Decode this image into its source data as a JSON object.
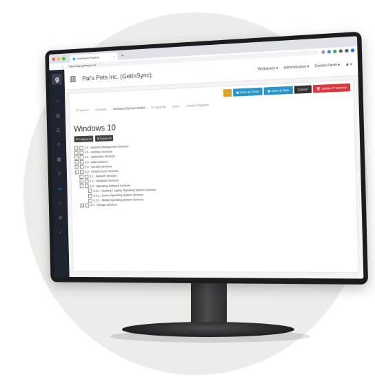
{
  "browser": {
    "tab_title": "GetInSync Platform",
    "new_tab": "+",
    "url": "https://app.getinsync.ca",
    "window_dots": [
      "#ff5f57",
      "#febc2e",
      "#28c840"
    ],
    "extension_colors": [
      "#9aa0a6",
      "#4a90d9",
      "#34a853",
      "#5f6368",
      "#5f6368",
      "#1a73e8"
    ]
  },
  "sidebar": {
    "logo": "g",
    "items": [
      "home-icon",
      "document-icon",
      "list-icon",
      "lightbulb-icon",
      "chart-icon",
      "shield-icon",
      "monitor-icon",
      "users-icon",
      "settings-icon",
      "check-icon"
    ]
  },
  "header": {
    "company": "Pal's Pets Inc. (GetInSync)",
    "nav": [
      "Workspace ▾",
      "Administration ▾",
      "Control Panel ▾",
      "♟ ▾"
    ]
  },
  "actions": {
    "info": "!",
    "save_close": "Save & Close",
    "save_new": "Save & New",
    "cancel": "Cancel",
    "delete": "Delete IT Service",
    "colors": {
      "info": "#e0a020",
      "save": "#2a95c9",
      "cancel": "#333333",
      "delete": "#d9363e"
    }
  },
  "tabs": [
    "IT Service",
    "Contacts",
    "Technical Service Model",
    "In Used By",
    "Uses",
    "Context Diagram"
  ],
  "page_title": "Windows 10",
  "tree_buttons": {
    "collapse": "Collapse All",
    "expand": "Expand All"
  },
  "tree": [
    {
      "level": 0,
      "label": "1.0 - Systems Management Services",
      "expander": "+"
    },
    {
      "level": 0,
      "label": "2.0 - Interface Services",
      "expander": "+"
    },
    {
      "level": 0,
      "label": "3.0 - Application Services",
      "expander": "+"
    },
    {
      "level": 0,
      "label": "4.0 - Data Services",
      "expander": "+"
    },
    {
      "level": 0,
      "label": "5.0 - Security Services",
      "expander": "+"
    },
    {
      "level": 0,
      "label": "6.0 - Infrastructure Services",
      "expander": "−"
    },
    {
      "level": 1,
      "label": "6.1 - Network Services",
      "expander": "+"
    },
    {
      "level": 1,
      "label": "6.2 - Hardware Services",
      "expander": "+"
    },
    {
      "level": 1,
      "label": "6.3 - Operating Software Services",
      "expander": "−"
    },
    {
      "level": 2,
      "label": "6.3.1 - Desktop / Laptop Operating System Services",
      "expander": "",
      "checked": true
    },
    {
      "level": 2,
      "label": "6.3.2 - Server Operating System Services",
      "expander": ""
    },
    {
      "level": 2,
      "label": "6.3.3 - Mobile Operating System Services",
      "expander": ""
    },
    {
      "level": 1,
      "label": "6.4 - Storage Services",
      "expander": "+"
    }
  ]
}
